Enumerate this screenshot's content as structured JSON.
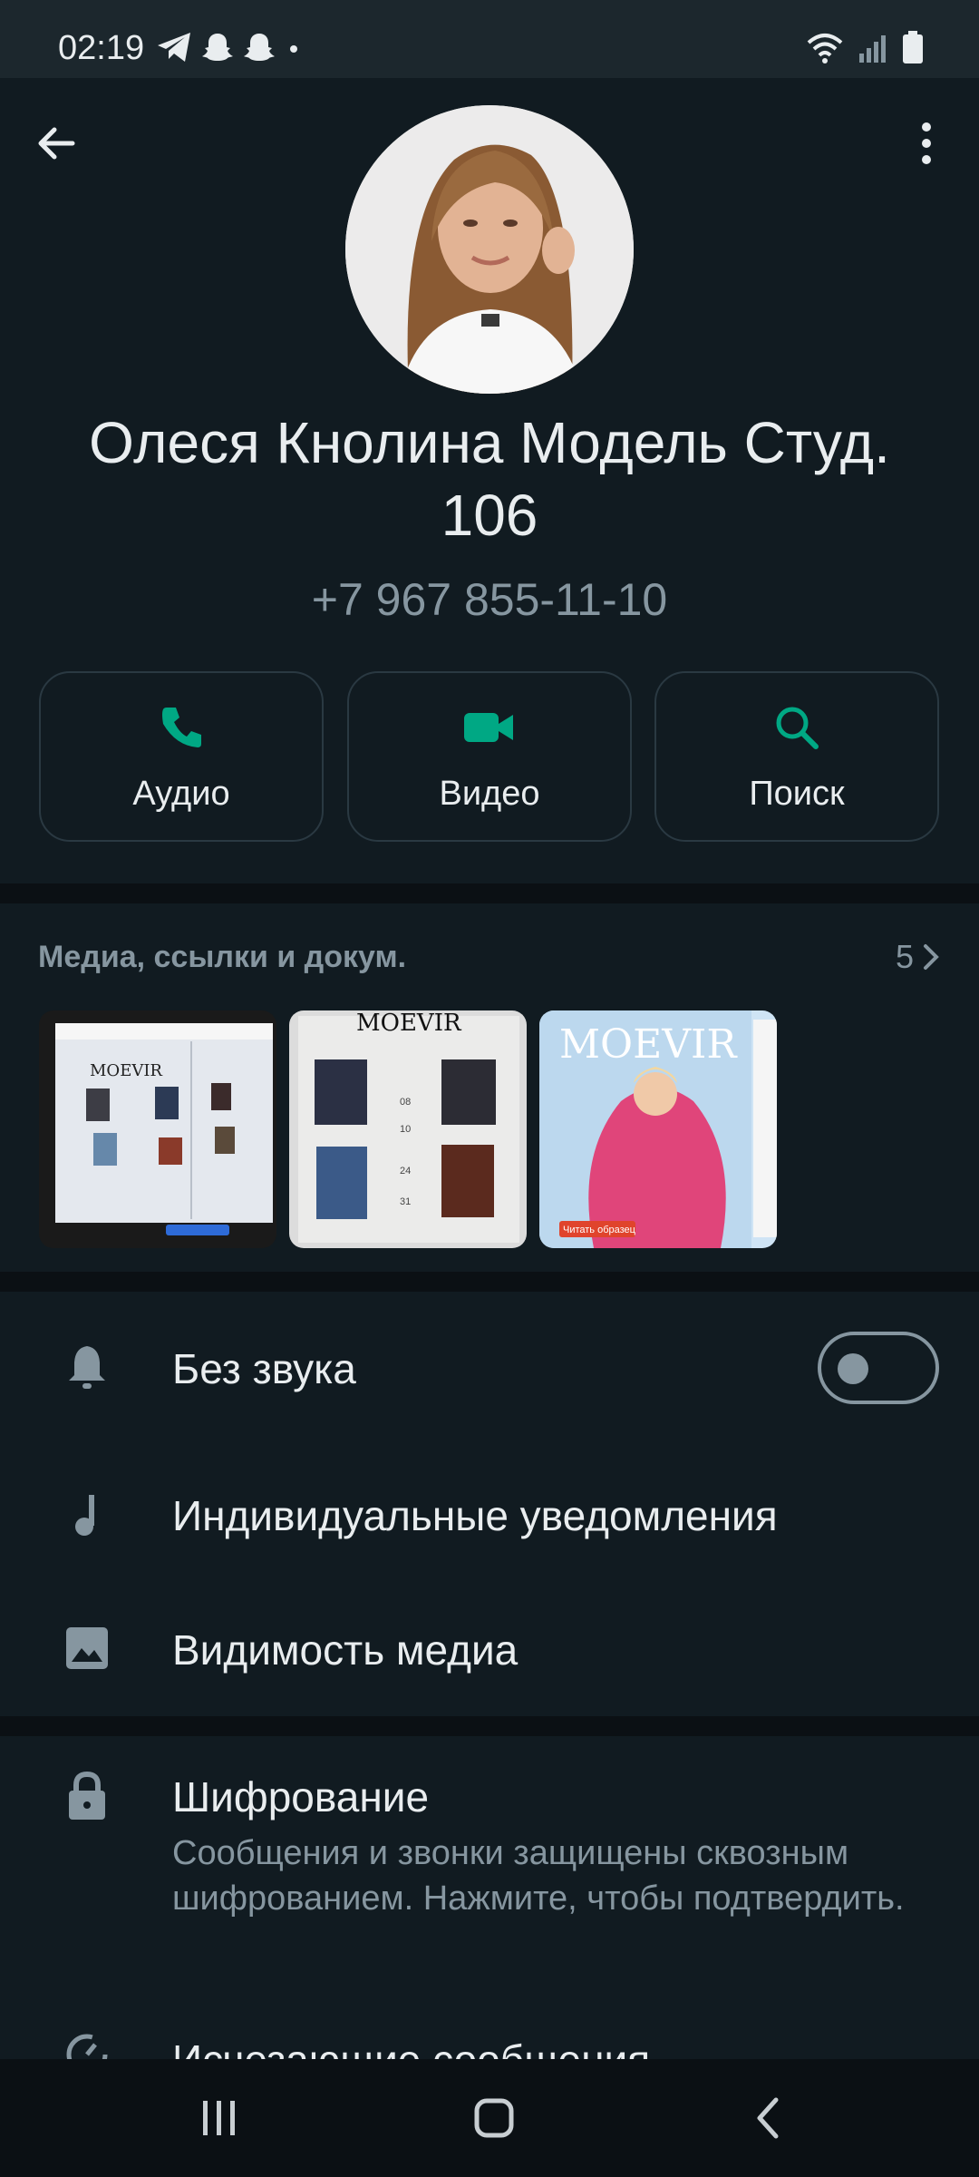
{
  "status_bar": {
    "time": "02:19",
    "left_icons": [
      "telegram-icon",
      "snapchat-icon",
      "snapchat-icon",
      "dot-icon"
    ],
    "right_icons": [
      "wifi-icon",
      "signal-icon",
      "battery-icon"
    ]
  },
  "header": {
    "back_icon": "arrow-left-icon",
    "menu_icon": "more-vertical-icon"
  },
  "contact": {
    "name_line1": "Олеся Кнолина Модель Студ.",
    "name_line2": "106",
    "phone": "+7 967 855-11-10"
  },
  "actions": [
    {
      "label": "Аудио",
      "icon": "phone-icon"
    },
    {
      "label": "Видео",
      "icon": "video-camera-icon"
    },
    {
      "label": "Поиск",
      "icon": "search-icon"
    }
  ],
  "media": {
    "title": "Медиа, ссылки и докум.",
    "count": "5",
    "thumbnails": [
      {
        "kind": "screen-photo",
        "caption": "MOEVIR"
      },
      {
        "kind": "magazine-page",
        "caption": "MOEVIR"
      },
      {
        "kind": "magazine-cover",
        "caption": "MOEVIR",
        "badge": "Читать образец"
      }
    ]
  },
  "settings": {
    "mute": {
      "label": "Без звука",
      "icon": "bell-icon",
      "enabled": false
    },
    "custom_notifications": {
      "label": "Индивидуальные уведомления",
      "icon": "music-note-icon"
    },
    "media_visibility": {
      "label": "Видимость медиа",
      "icon": "image-icon"
    }
  },
  "encryption": {
    "label": "Шифрование",
    "icon": "lock-icon",
    "description": "Сообщения и звонки защищены сквозным шифрованием. Нажмите, чтобы подтвердить."
  },
  "disappearing": {
    "label": "Исчезающие сообщения",
    "icon": "timer-icon"
  },
  "colors": {
    "accent": "#00a884",
    "background": "#111b21",
    "secondary_text": "#8696a0"
  },
  "navbar": [
    "recents-icon",
    "home-icon",
    "back-icon"
  ]
}
